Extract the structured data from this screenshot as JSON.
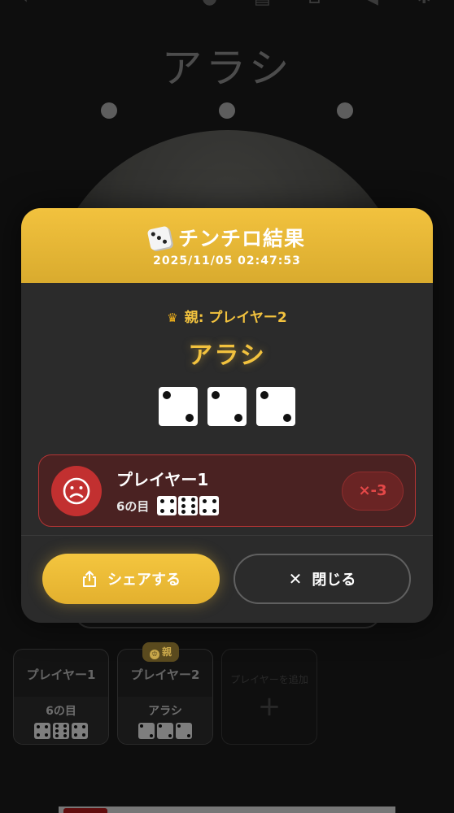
{
  "app": {
    "title": "アラシ"
  },
  "background": {
    "players": [
      {
        "name": "プレイヤー1",
        "result": "6の目",
        "dice": [
          4,
          6,
          4
        ]
      },
      {
        "name": "プレイヤー2",
        "result": "アラシ",
        "dice": [
          2,
          2,
          2
        ],
        "is_parent": true
      },
      {
        "add_label": "プレイヤーを追加"
      }
    ],
    "parent_badge": "親"
  },
  "modal": {
    "title": "チンチロ結果",
    "datetime": "2025/11/05 02:47:53",
    "parent_line": "親: プレイヤー2",
    "result_name": "アラシ",
    "dice": [
      2,
      2,
      2
    ],
    "loser": {
      "name": "プレイヤー1",
      "result": "6の目",
      "dice": [
        4,
        6,
        4
      ],
      "multiplier": "×-3"
    },
    "share_label": "シェアする",
    "close_label": "閉じる"
  },
  "icons": {
    "dice": "game-die-icon",
    "crown": "crown-icon",
    "sad": "sad-face-icon",
    "share": "share-icon",
    "close": "close-icon"
  },
  "colors": {
    "accent": "#f2c23e",
    "danger": "#c23030",
    "background": "#1a1a1a"
  }
}
